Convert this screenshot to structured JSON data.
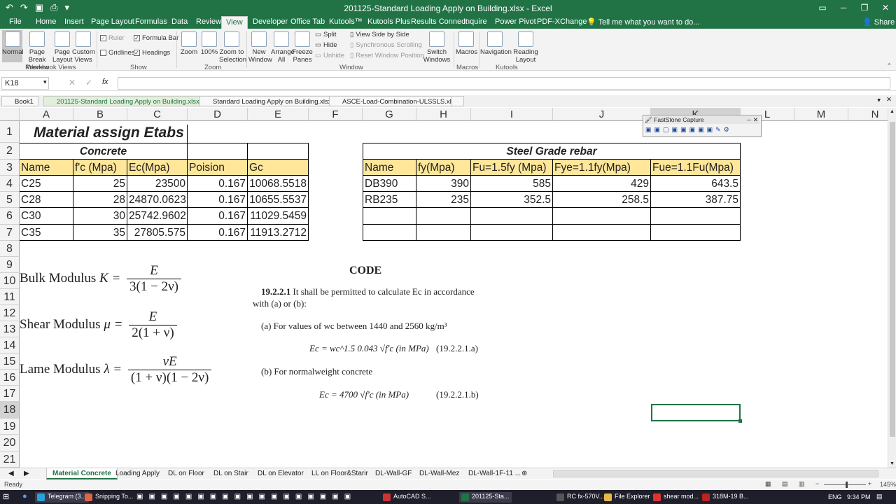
{
  "window": {
    "title": "201125-Standard Loading Apply on Building.xlsx - Excel",
    "share": "Share"
  },
  "ribbon_tabs": [
    "File",
    "Home",
    "Insert",
    "Page Layout",
    "Formulas",
    "Data",
    "Review",
    "View",
    "Developer",
    "Office Tab",
    "Kutools™",
    "Kutools Plus",
    "Results Connect",
    "Inquire",
    "Power Pivot",
    "PDF-XChange"
  ],
  "tell_me": "Tell me what you want to do...",
  "ribbon": {
    "normal": "Normal",
    "page_break": "Page Break Preview",
    "page_layout": "Page Layout",
    "custom_views": "Custom Views",
    "ruler": "Ruler",
    "formula_bar": "Formula Bar",
    "gridlines": "Gridlines",
    "headings": "Headings",
    "zoom": "Zoom",
    "zoom100": "100%",
    "zoom_sel": "Zoom to Selection",
    "new_window": "New Window",
    "arrange_all": "Arrange All",
    "freeze_panes": "Freeze Panes",
    "split": "Split",
    "hide": "Hide",
    "unhide": "Unhide",
    "side_by_side": "View Side by Side",
    "sync_scroll": "Synchronous Scrolling",
    "reset_pos": "Reset Window Position",
    "switch_windows": "Switch Windows",
    "macros": "Macros",
    "navigation": "Navigation",
    "reading_layout": "Reading Layout",
    "groups": {
      "workbook_views": "Workbook Views",
      "show": "Show",
      "zoom": "Zoom",
      "window": "Window",
      "macros": "Macros",
      "kutools": "Kutools"
    }
  },
  "namebox": "K18",
  "fx": "fx",
  "doc_tabs": [
    "Book1",
    "201125-Standard Loading Apply on Building.xlsx *",
    "Standard Loading Apply on Building.xlsx",
    "ASCE-Load-Combination-ULSSLS.xlsx"
  ],
  "columns": [
    "A",
    "B",
    "C",
    "D",
    "E",
    "F",
    "G",
    "H",
    "I",
    "J",
    "K",
    "L",
    "M",
    "N"
  ],
  "rows": [
    "1",
    "2",
    "3",
    "4",
    "5",
    "6",
    "7",
    "8",
    "9",
    "10",
    "11",
    "12",
    "13",
    "14",
    "15",
    "16",
    "17",
    "18",
    "19",
    "20",
    "21"
  ],
  "sheet": {
    "title": "Material assign Etabs",
    "concrete": {
      "label": "Concrete",
      "headers": [
        "Name",
        "f'c (Mpa)",
        "Ec(Mpa)",
        "Poision",
        "Gc"
      ],
      "rows": [
        [
          "C25",
          "25",
          "23500",
          "0.167",
          "10068.5518"
        ],
        [
          "C28",
          "28",
          "24870.0623",
          "0.167",
          "10655.5537"
        ],
        [
          "C30",
          "30",
          "25742.9602",
          "0.167",
          "11029.5459"
        ],
        [
          "C35",
          "35",
          "27805.575",
          "0.167",
          "11913.2712"
        ]
      ]
    },
    "steel": {
      "label": "Steel Grade rebar",
      "headers": [
        "Name",
        "fy(Mpa)",
        "Fu=1.5fy (Mpa)",
        "Fye=1.1fy(Mpa)",
        "Fue=1.1Fu(Mpa)"
      ],
      "rows": [
        [
          "DB390",
          "390",
          "585",
          "429",
          "643.5"
        ],
        [
          "RB235",
          "235",
          "352.5",
          "258.5",
          "387.75"
        ]
      ]
    }
  },
  "formulas": {
    "bulk": {
      "label": "Bulk Modulus",
      "sym": "K =",
      "num": "E",
      "den": "3(1 − 2ν)"
    },
    "shear": {
      "label": "Shear Modulus",
      "sym": "μ =",
      "num": "E",
      "den": "2(1 + ν)"
    },
    "lame": {
      "label": "Lame Modulus",
      "sym": "λ =",
      "num": "νE",
      "den": "(1 + ν)(1 − 2ν)"
    }
  },
  "code": {
    "title": "CODE",
    "clause": "19.2.2.1",
    "clause_text": "It shall be permitted to calculate Ec in accordance",
    "clause_text2": "with (a) or (b):",
    "a": "(a) For values of wc between 1440 and 2560 kg/m³",
    "eq_a": "Ec = wc^1.5 0.043 √f'c  (in MPa)",
    "eq_a_ref": "(19.2.2.1.a)",
    "b": "(b) For normalweight concrete",
    "eq_b": "Ec = 4700 √f'c  (in MPa)",
    "eq_b_ref": "(19.2.2.1.b)"
  },
  "fastone": {
    "title": "FastStone Capture"
  },
  "sheet_tabs": [
    "Material Concrete",
    "Loading Apply",
    "DL on Floor",
    "DL on Stair",
    "DL on Elevator",
    "LL on Floor&Starir",
    "DL-Wall-GF",
    "DL-Wall-Mez",
    "DL-Wall-1F-11 ..."
  ],
  "status": {
    "ready": "Ready",
    "zoom": "145%"
  },
  "taskbar": {
    "items": [
      "Telegram (3...",
      "Snipping To...",
      "AutoCAD S...",
      "201125-Sta...",
      "RC fx-570V...",
      "File Explorer",
      "shear mod...",
      "318M-19 B..."
    ],
    "lang": "ENG",
    "time": "9:34 PM"
  }
}
